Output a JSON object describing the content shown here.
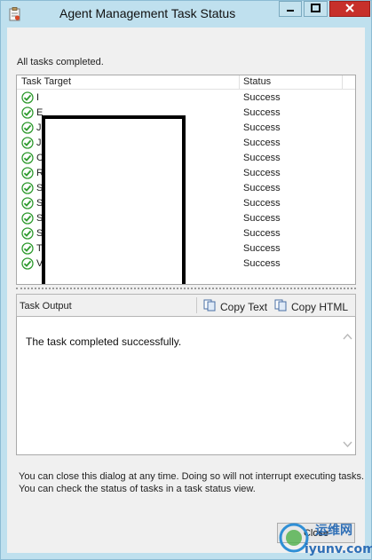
{
  "window": {
    "title": "Agent Management Task Status",
    "icon": "task-status-icon",
    "controls": {
      "minimize": "minimize-icon",
      "maximize": "maximize-icon",
      "close": "close-icon"
    }
  },
  "status_text": "All tasks completed.",
  "task_list": {
    "columns": {
      "target": "Task Target",
      "status": "Status"
    },
    "rows": [
      {
        "target": "I",
        "status": "Success"
      },
      {
        "target": "E",
        "status": "Success"
      },
      {
        "target": "J",
        "status": "Success"
      },
      {
        "target": "J",
        "status": "Success"
      },
      {
        "target": "C",
        "status": "Success"
      },
      {
        "target": "R",
        "status": "Success"
      },
      {
        "target": "S",
        "status": "Success"
      },
      {
        "target": "S",
        "status": "Success"
      },
      {
        "target": "S",
        "status": "Success"
      },
      {
        "target": "S",
        "status": "Success"
      },
      {
        "target": "T",
        "status": "Success"
      },
      {
        "target": "V",
        "status": "Success"
      }
    ]
  },
  "task_output": {
    "title": "Task Output",
    "copy_text": "Copy Text",
    "copy_html": "Copy HTML",
    "message": "The task completed successfully."
  },
  "hint": "You can close this dialog at any time. Doing so will not interrupt executing tasks. You can check the status of tasks in a task status view.",
  "buttons": {
    "close": "Close"
  },
  "watermark": {
    "line1": "运维网",
    "line2": "iyunv.com"
  },
  "colors": {
    "success": "#2e9a2e",
    "title_bar": "#bfe0ee",
    "close_button": "#c7302b"
  }
}
